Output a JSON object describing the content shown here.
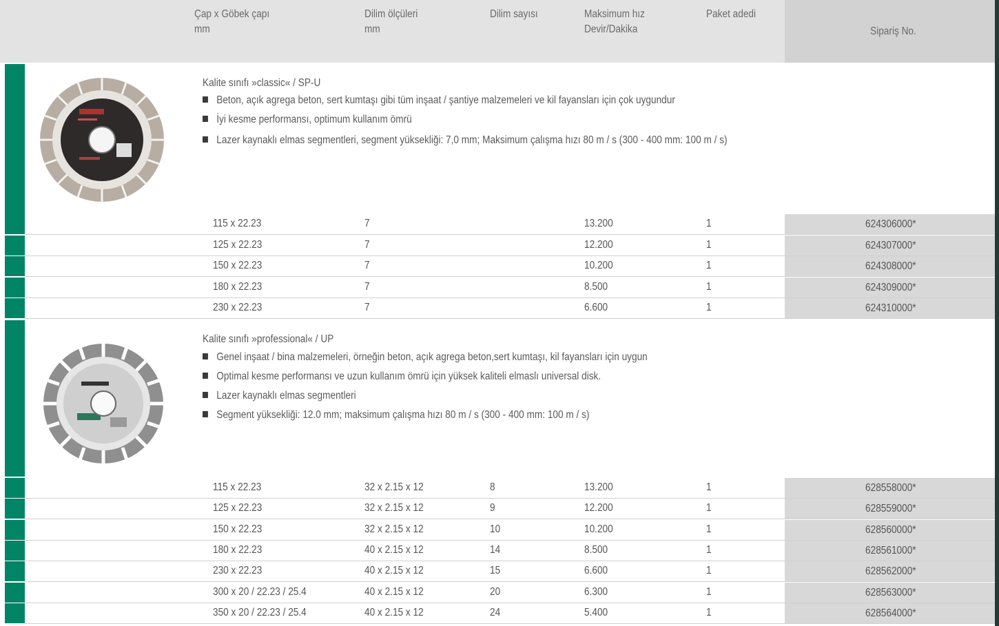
{
  "header": {
    "col_diameter": [
      "Çap x Göbek çapı",
      "mm"
    ],
    "col_segment": [
      "Dilim ölçüleri",
      "mm"
    ],
    "col_segcount": [
      "Dilim sayısı"
    ],
    "col_speed": [
      "Maksimum hız",
      "Devir/Dakika"
    ],
    "col_pack": [
      "Paket adedi"
    ],
    "col_order": "Sipariş  No."
  },
  "sections": [
    {
      "title": "Kalite sınıfı »classic« / SP-U",
      "bullets": [
        "Beton, açık agrega beton, sert kumtaşı gibi tüm inşaat / şantiye malzemeleri ve kil fayansları için çok uygundur",
        "İyi kesme performansı, optimum kullanım ömrü",
        "Lazer kaynaklı elmas segmentleri, segment yüksekliği: 7,0 mm; Maksimum çalışma hızı 80 m / s (300 - 400 mm: 100 m / s)"
      ],
      "rows": [
        [
          "115 x 22.23",
          "7",
          "",
          "13.200",
          "1",
          "624306000*"
        ],
        [
          "125 x 22.23",
          "7",
          "",
          "12.200",
          "1",
          "624307000*"
        ],
        [
          "150 x 22.23",
          "7",
          "",
          "10.200",
          "1",
          "624308000*"
        ],
        [
          "180 x 22.23",
          "7",
          "",
          "8.500",
          "1",
          "624309000*"
        ],
        [
          "230 x 22.23",
          "7",
          "",
          "6.600",
          "1",
          "624310000*"
        ]
      ]
    },
    {
      "title": "Kalite sınıfı »professional« / UP",
      "bullets": [
        "Genel inşaat / bina malzemeleri, örneğin beton, açık agrega beton,sert kumtaşı, kil fayansları için uygun",
        "Optimal kesme performansı ve uzun kullanım ömrü için yüksek kaliteli elmaslı universal disk.",
        "Lazer kaynaklı elmas segmentleri",
        "Segment yüksekliği: 12.0 mm; maksimum çalışma hızı 80 m / s (300 - 400 mm: 100 m / s)"
      ],
      "rows": [
        [
          "115 x 22.23",
          "32 x 2.15 x 12",
          "8",
          "13.200",
          "1",
          "628558000*"
        ],
        [
          "125 x 22.23",
          "32 x 2.15 x 12",
          "9",
          "12.200",
          "1",
          "628559000*"
        ],
        [
          "150 x 22.23",
          "32 x 2.15 x 12",
          "10",
          "10.200",
          "1",
          "628560000*"
        ],
        [
          "180 x 22.23",
          "40 x 2.15 x 12",
          "14",
          "8.500",
          "1",
          "628561000*"
        ],
        [
          "230 x 22.23",
          "40 x 2.15 x 12",
          "15",
          "6.600",
          "1",
          "628562000*"
        ],
        [
          "300 x 20 / 22.23 / 25.4",
          "40 x 2.15 x 12",
          "20",
          "6.300",
          "1",
          "628563000*"
        ],
        [
          "350 x 20 / 22.23 / 25.4",
          "40 x 2.15 x 12",
          "24",
          "5.400",
          "1",
          "628564000*"
        ]
      ]
    }
  ],
  "colors": {
    "accent_green": "#008466",
    "header_bg": "#e3e3e3",
    "order_bg": "#d8d8d8"
  },
  "icons": [
    "classic-diamond-disc-icon",
    "professional-diamond-disc-icon"
  ]
}
